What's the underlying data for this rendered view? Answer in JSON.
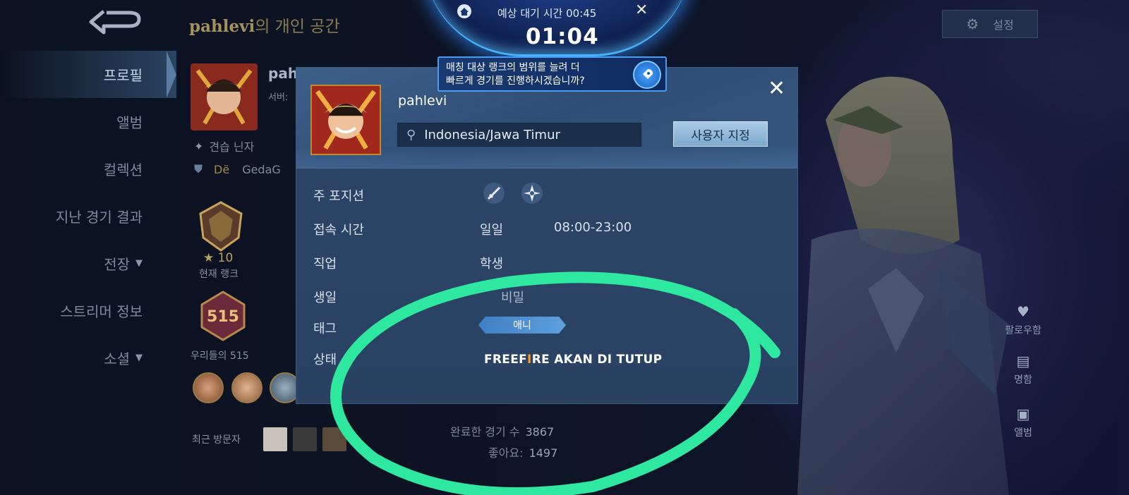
{
  "header": {
    "title_name": "pahlevi",
    "title_suffix": "의 개인 공간",
    "settings_label": "설정"
  },
  "nav": {
    "items": [
      {
        "label": "프로필",
        "active": true
      },
      {
        "label": "앨범"
      },
      {
        "label": "컬렉션"
      },
      {
        "label": "지난 경기 결과"
      },
      {
        "label": "전장",
        "chevron": true
      },
      {
        "label": "스트리머 정보"
      },
      {
        "label": "소셜",
        "chevron": true
      }
    ]
  },
  "profile_bg": {
    "name": "pahl",
    "server_label": "서버:",
    "title": "견습 닌자",
    "squad_prefix": "Dë",
    "squad_name": "GedaG",
    "rank_stars": "10",
    "rank_label": "현재 랭크",
    "badge_number": "515",
    "badge_label": "우리들의 515",
    "visitors_label": "최근 방문자",
    "matches_label": "완료한 경기 수",
    "matches_value": "3867",
    "likes_label": "좋아요:",
    "likes_value": "1497"
  },
  "matchmaking": {
    "wait_label": "예상 대기 시간 00:45",
    "timer": "01:04",
    "tip_line1": "매칭 대상 랭크의 범위를 늘려 더",
    "tip_line2": "빠르게 경기를 진행하시겠습니까?"
  },
  "modal": {
    "name": "pahlevi",
    "location": "Indonesia/Jawa Timur",
    "custom_button": "사용자 지정",
    "rows": {
      "position_label": "주 포지션",
      "online_label": "접속 시간",
      "online_days": "일일",
      "online_hours": "08:00-23:00",
      "job_label": "직업",
      "job_value": "학생",
      "birthday_label": "생일",
      "birthday_value": "비밀",
      "tag_label": "태그",
      "tag_value": "애니",
      "status_label": "상태"
    },
    "status_part1": "FREEF",
    "status_hl": "I",
    "status_part2": "RE AKAN DI TUTUP"
  },
  "side_actions": {
    "follow": "팔로우함",
    "card": "명함",
    "album": "앨범"
  },
  "colors": {
    "accent_blue": "#46b4ff",
    "highlight_green": "#2ee8a0",
    "status_orange": "#ff9a2a"
  }
}
